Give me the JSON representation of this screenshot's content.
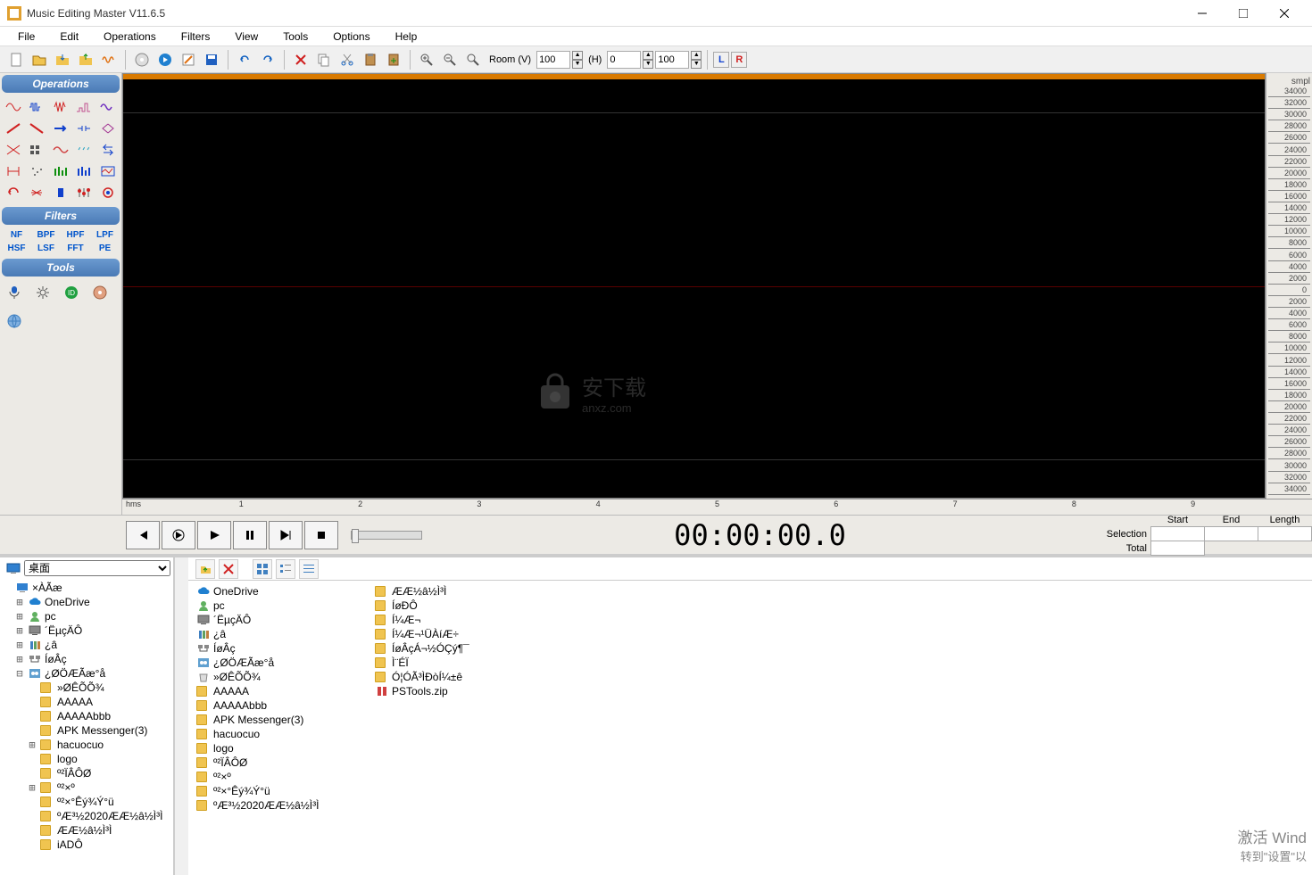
{
  "window": {
    "title": "Music Editing Master V11.6.5"
  },
  "menu": [
    "File",
    "Edit",
    "Operations",
    "Filters",
    "View",
    "Tools",
    "Options",
    "Help"
  ],
  "toolbar": {
    "room_v_label": "Room (V)",
    "room_v_value": "100",
    "h_label": "(H)",
    "h_value": "0",
    "h2_value": "100",
    "left_channel": "L",
    "right_channel": "R"
  },
  "side": {
    "operations_title": "Operations",
    "filters_title": "Filters",
    "tools_title": "Tools",
    "filters": [
      "NF",
      "BPF",
      "HPF",
      "LPF",
      "HSF",
      "LSF",
      "FFT",
      "PE"
    ]
  },
  "wave": {
    "amp_label": "smpl",
    "amp_ticks": [
      "34000",
      "32000",
      "30000",
      "28000",
      "26000",
      "24000",
      "22000",
      "20000",
      "18000",
      "16000",
      "14000",
      "12000",
      "10000",
      "8000",
      "6000",
      "4000",
      "2000",
      "0",
      "2000",
      "4000",
      "6000",
      "8000",
      "10000",
      "12000",
      "14000",
      "16000",
      "18000",
      "20000",
      "22000",
      "24000",
      "26000",
      "28000",
      "30000",
      "32000",
      "34000"
    ],
    "time_label": "hms",
    "time_ticks": [
      "1",
      "2",
      "3",
      "4",
      "5",
      "6",
      "7",
      "8",
      "9"
    ]
  },
  "transport": {
    "timecode": "00:00:00.0",
    "labels": {
      "start": "Start",
      "end": "End",
      "length": "Length",
      "selection": "Selection",
      "total": "Total"
    }
  },
  "browser": {
    "dropdown_selected": "桌面",
    "tree": [
      {
        "indent": 0,
        "exp": "",
        "icon": "desktop",
        "label": "×ÀÃæ"
      },
      {
        "indent": 1,
        "exp": "+",
        "icon": "cloud",
        "label": "OneDrive"
      },
      {
        "indent": 1,
        "exp": "+",
        "icon": "user",
        "label": "pc"
      },
      {
        "indent": 1,
        "exp": "+",
        "icon": "pc",
        "label": "´ËµçÄÔ"
      },
      {
        "indent": 1,
        "exp": "+",
        "icon": "lib",
        "label": "¿â"
      },
      {
        "indent": 1,
        "exp": "+",
        "icon": "net",
        "label": "ÍøÂç"
      },
      {
        "indent": 1,
        "exp": "-",
        "icon": "panel",
        "label": "¿ØÖÆÃæ°å"
      },
      {
        "indent": 2,
        "exp": "",
        "icon": "folder",
        "label": "»ØÊÕÕ¾"
      },
      {
        "indent": 2,
        "exp": "",
        "icon": "folder",
        "label": "AAAAA"
      },
      {
        "indent": 2,
        "exp": "",
        "icon": "folder",
        "label": "AAAAAbbb"
      },
      {
        "indent": 2,
        "exp": "",
        "icon": "folder",
        "label": "APK Messenger(3)"
      },
      {
        "indent": 2,
        "exp": "+",
        "icon": "folder",
        "label": "hacuocuo"
      },
      {
        "indent": 2,
        "exp": "",
        "icon": "folder",
        "label": "logo"
      },
      {
        "indent": 2,
        "exp": "",
        "icon": "folder",
        "label": "º²ÏÂÔØ"
      },
      {
        "indent": 2,
        "exp": "+",
        "icon": "folder",
        "label": "º²×º"
      },
      {
        "indent": 2,
        "exp": "",
        "icon": "folder",
        "label": "º²×°Êý¾Ý°ü"
      },
      {
        "indent": 2,
        "exp": "",
        "icon": "folder",
        "label": "ºÆ³½2020ÆÆ½â½Ì³Ì"
      },
      {
        "indent": 2,
        "exp": "",
        "icon": "folder",
        "label": "ÆÆ½â½Ì³Ì"
      },
      {
        "indent": 2,
        "exp": "",
        "icon": "folder",
        "label": "iADÔ"
      }
    ],
    "col1": [
      {
        "icon": "cloud",
        "label": "OneDrive"
      },
      {
        "icon": "user",
        "label": "pc"
      },
      {
        "icon": "pc",
        "label": "´ËµçÄÔ"
      },
      {
        "icon": "lib",
        "label": "¿â"
      },
      {
        "icon": "net",
        "label": "ÍøÂç"
      },
      {
        "icon": "panel",
        "label": "¿ØÖÆÃæ°å"
      },
      {
        "icon": "recycle",
        "label": "»ØÊÕÕ¾"
      },
      {
        "icon": "folder",
        "label": "AAAAA"
      },
      {
        "icon": "folder",
        "label": "AAAAAbbb"
      },
      {
        "icon": "folder",
        "label": "APK Messenger(3)"
      },
      {
        "icon": "folder",
        "label": "hacuocuo"
      },
      {
        "icon": "folder",
        "label": "logo"
      },
      {
        "icon": "folder",
        "label": "º²ÏÂÔØ"
      },
      {
        "icon": "folder",
        "label": "º²×º"
      },
      {
        "icon": "folder",
        "label": "º²×°Êý¾Ý°ü"
      },
      {
        "icon": "folder",
        "label": "ºÆ³½2020ÆÆ½â½Ì³Ì"
      }
    ],
    "col2": [
      {
        "icon": "folder",
        "label": "ÆÆ½â½Ì³Ì"
      },
      {
        "icon": "folder",
        "label": "ÍøÐÔ"
      },
      {
        "icon": "folder",
        "label": "Í¼Æ¬"
      },
      {
        "icon": "folder",
        "label": "Í¼Æ¬¹ÜÀíÆ÷"
      },
      {
        "icon": "folder",
        "label": "ÍøÂçÁ¬½ÓÇý¶¯"
      },
      {
        "icon": "folder",
        "label": "Ì¨ÉÏ"
      },
      {
        "icon": "folder",
        "label": "Ó¦ÓÃ³ÌÐòÍ¼±ê"
      },
      {
        "icon": "zip",
        "label": "PSTools.zip"
      }
    ]
  },
  "watermark": {
    "cn": "安下载",
    "url": "anxz.com"
  },
  "activate": {
    "line1": "激活 Wind",
    "line2": "转到\"设置\"以"
  }
}
